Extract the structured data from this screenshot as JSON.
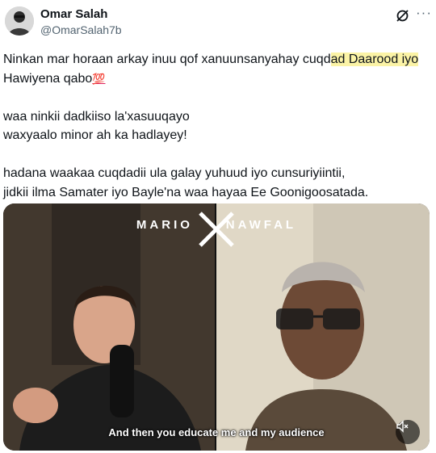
{
  "author": {
    "display_name": "Omar Salah",
    "handle": "@OmarSalah7b"
  },
  "icons": {
    "grok": "grok-icon",
    "more": "more-icon",
    "mute": "speaker-muted-icon"
  },
  "post": {
    "line1_before": "Ninkan mar horaan arkay inuu qof xanuunsanyahay cuqd",
    "line1_highlight": "ad Daarood iyo",
    "line2": "Hawiyena qabo",
    "line2_emoji": "💯",
    "line3": "waa ninkii dadkiiso la'xasuuqayo",
    "line4": "waxyaalo minor ah ka hadlayey!",
    "line5": "hadana waakaa cuqdadii ula galay yuhuud iyo cunsuriyiintii,",
    "line6": "jidkii ilma Samater iyo Bayle'na waa hayaa Ee Goonigoosatada."
  },
  "video": {
    "brand_left": "MARIO",
    "brand_right": "NAWFAL",
    "caption": "And then you educate me and my audience"
  },
  "colors": {
    "highlight": "#fbf3a6",
    "secondary_text": "#536471"
  }
}
